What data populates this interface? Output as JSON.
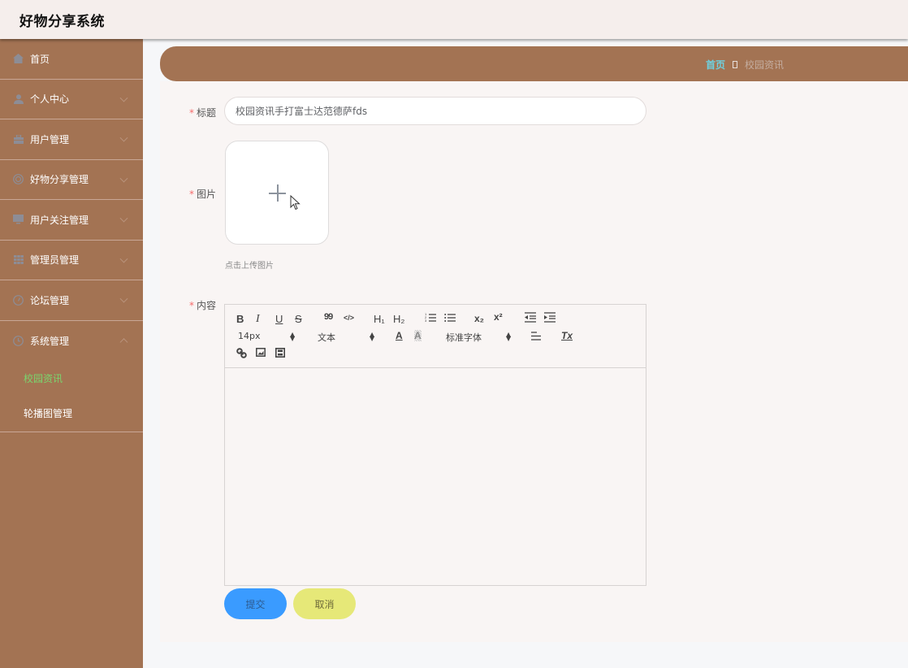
{
  "app": {
    "title": "好物分享系统"
  },
  "sidebar": {
    "items": [
      {
        "label": "首页",
        "icon": "home-icon",
        "expandable": false
      },
      {
        "label": "个人中心",
        "icon": "user-icon",
        "expandable": true
      },
      {
        "label": "用户管理",
        "icon": "briefcase-icon",
        "expandable": true
      },
      {
        "label": "好物分享管理",
        "icon": "lifebuoy-icon",
        "expandable": true
      },
      {
        "label": "用户关注管理",
        "icon": "monitor-icon",
        "expandable": true
      },
      {
        "label": "管理员管理",
        "icon": "grid-icon",
        "expandable": true
      },
      {
        "label": "论坛管理",
        "icon": "gauge-icon",
        "expandable": true
      },
      {
        "label": "系统管理",
        "icon": "clock-icon",
        "expandable": true,
        "expanded": true
      }
    ],
    "sub_items": [
      {
        "label": "校园资讯",
        "active": true
      },
      {
        "label": "轮播图管理",
        "active": false
      }
    ],
    "active_color": "#7ad66e",
    "bg_color": "#a37353"
  },
  "breadcrumb": {
    "home": "首页",
    "current": "校园资讯"
  },
  "form": {
    "title_label": "标题",
    "title_value": "校园资讯手打富士达范德萨fds",
    "image_label": "图片",
    "upload_hint": "点击上传图片",
    "content_label": "内容",
    "required_mark": "*",
    "editor": {
      "font_size": "14px",
      "paragraph": "文本",
      "font_family": "标准字体",
      "buttons": [
        "bold",
        "italic",
        "underline",
        "strike",
        "blockquote",
        "code-block",
        "header-1",
        "header-2",
        "ordered-list",
        "bullet-list",
        "subscript",
        "superscript",
        "outdent",
        "indent",
        "font-color",
        "background-color",
        "align",
        "clean",
        "link",
        "image",
        "video"
      ],
      "glyphs": {
        "bold": "B",
        "italic": "I",
        "underline": "U",
        "strike": "S",
        "blockquote": "99",
        "code": "</>",
        "h1": "H₁",
        "h2": "H₂",
        "sub": "x₂",
        "sup": "x²",
        "color": "A",
        "bg": "A",
        "clean": "Tx"
      },
      "content": ""
    },
    "submit_label": "提交",
    "cancel_label": "取消",
    "submit_color": "#3a9bff",
    "cancel_color": "#e6e878"
  }
}
